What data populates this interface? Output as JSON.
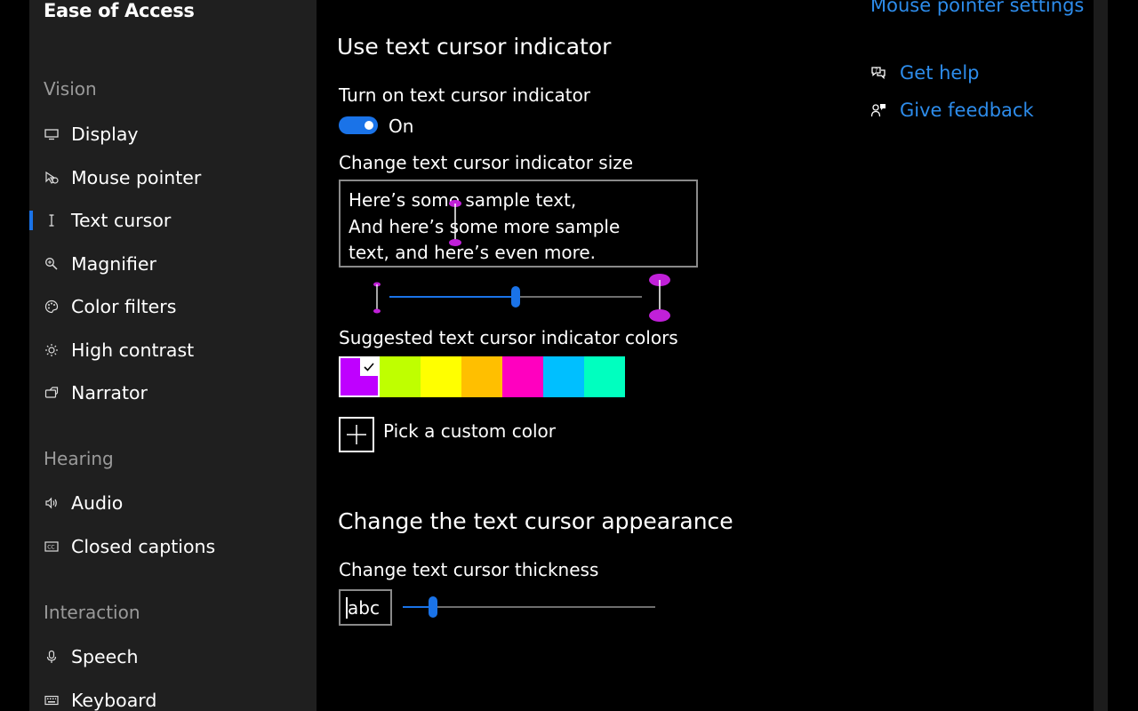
{
  "sidebar": {
    "title": "Ease of Access",
    "sections": {
      "vision": "Vision",
      "hearing": "Hearing",
      "interaction": "Interaction"
    },
    "items": {
      "display": "Display",
      "mouse_pointer": "Mouse pointer",
      "text_cursor": "Text cursor",
      "magnifier": "Magnifier",
      "color_filters": "Color filters",
      "high_contrast": "High contrast",
      "narrator": "Narrator",
      "audio": "Audio",
      "closed_captions": "Closed captions",
      "speech": "Speech",
      "keyboard": "Keyboard"
    },
    "selected": "text_cursor"
  },
  "main": {
    "indicator_heading": "Use text cursor indicator",
    "toggle_label": "Turn on text cursor indicator",
    "toggle_state": "On",
    "toggle_on": true,
    "size_label": "Change text cursor indicator size",
    "sample_lines": [
      "Here’s some sample text,",
      "And here’s some more sample",
      "text, and here’s even more."
    ],
    "size_slider_fraction": 0.5,
    "colors_label": "Suggested text cursor indicator colors",
    "swatches": [
      "#bf00ff",
      "#bfff00",
      "#ffff00",
      "#ffbf00",
      "#ff00bf",
      "#00bfff",
      "#00ffbf"
    ],
    "selected_swatch": 0,
    "indicator_color": "#c020d8",
    "custom_color_label": "Pick a custom color",
    "appearance_heading": "Change the text cursor appearance",
    "thickness_label": "Change text cursor thickness",
    "thickness_preview": "abc",
    "thickness_slider_fraction": 0.12
  },
  "right": {
    "mouse_pointer_settings": "Mouse pointer settings",
    "get_help": "Get help",
    "give_feedback": "Give feedback"
  },
  "colors": {
    "accent": "#1a73e8",
    "link": "#2d8ceb",
    "sidebar_bg": "#1f1f1f",
    "page_bg": "#000000"
  }
}
